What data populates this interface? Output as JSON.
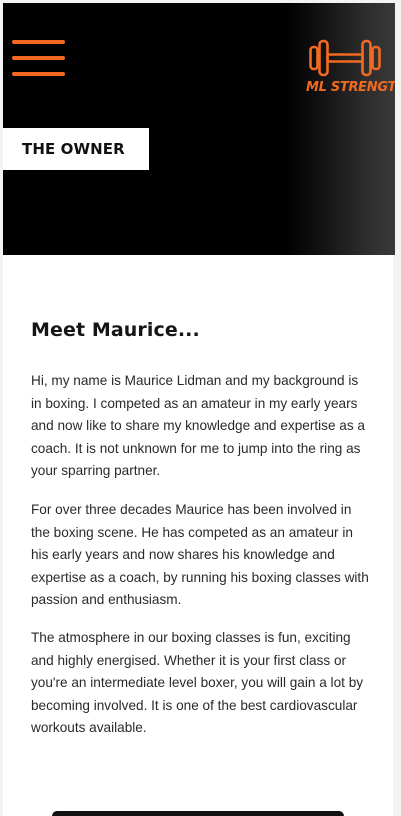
{
  "header": {
    "menu_icon": "hamburger-menu-icon",
    "logo": {
      "icon": "dumbbell-icon",
      "text": "ML STRENGTH"
    },
    "page_label": "THE OWNER"
  },
  "main": {
    "heading": "Meet Maurice...",
    "paragraphs": [
      "Hi, my name is Maurice Lidman and my background is in boxing. I competed as an amateur in my early years and now like to share my knowledge and expertise as a coach. It is not unknown for me to jump into the ring as your sparring partner.",
      "For over three decades Maurice has been involved in the boxing scene. He has competed as an amateur in his early years and now shares his knowledge and expertise as a coach, by running his boxing classes with passion and enthusiasm.",
      "The atmosphere in our boxing classes is fun, exciting and highly energised. Whether it is your first class or you're an intermediate level boxer, you will gain a lot by becoming involved. It is one of the best cardiovascular workouts available."
    ]
  },
  "colors": {
    "accent": "#f26a21",
    "hero_background": "#000000",
    "label_background": "#ffffff",
    "page_background": "#f4f4f4",
    "text": "#2a2a2a"
  }
}
